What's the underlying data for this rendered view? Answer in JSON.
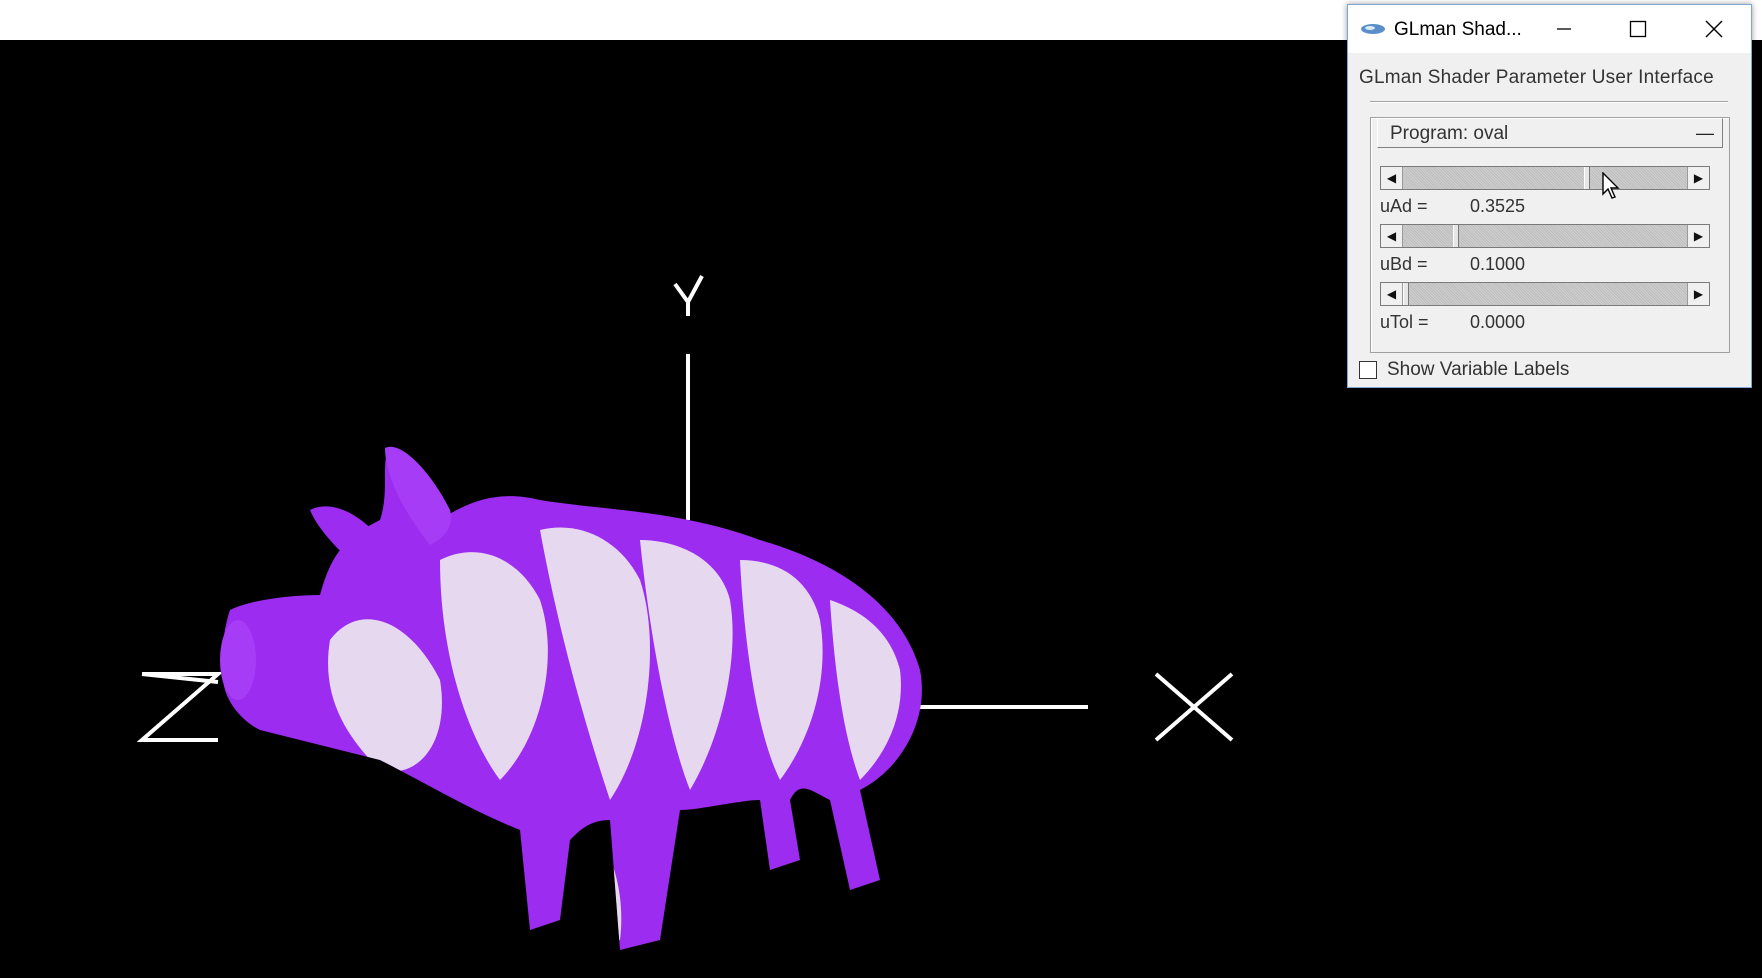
{
  "window": {
    "title": "GLman Shad...",
    "controls": {
      "minimize": "minimize-icon",
      "maximize": "maximize-icon",
      "close": "close-icon"
    }
  },
  "panel": {
    "header": "GLman Shader Parameter User Interface",
    "program_label": "Program: oval",
    "collapse_symbol": "—",
    "sliders": [
      {
        "name": "uAd =",
        "value": "0.3525",
        "position": 0.65
      },
      {
        "name": "uBd =",
        "value": "0.1000",
        "position": 0.18
      },
      {
        "name": "uTol =",
        "value": "0.0000",
        "position": 0.0
      }
    ],
    "show_labels": {
      "label": "Show Variable Labels",
      "checked": false
    }
  },
  "scene": {
    "axis_labels": {
      "x": "X",
      "y": "Y",
      "z": "Z"
    },
    "model": "pig",
    "colors": {
      "purple": "#9b2cf0",
      "light": "#e8dcef",
      "axes": "#ffffff",
      "background": "#000000"
    }
  }
}
